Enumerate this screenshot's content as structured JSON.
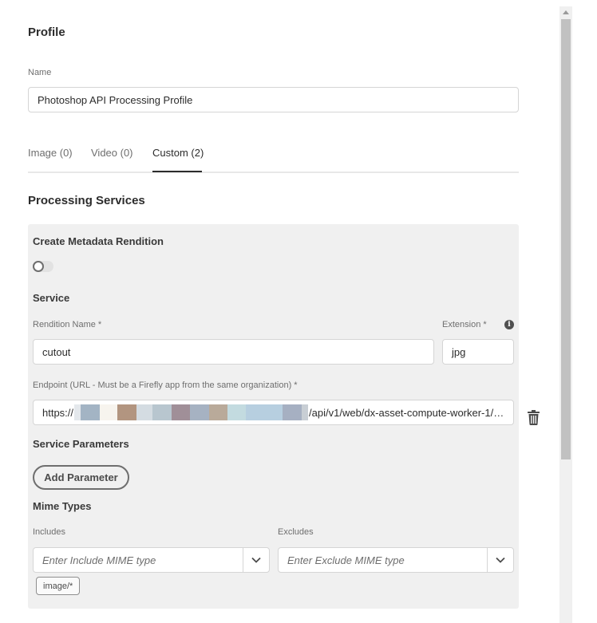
{
  "profile": {
    "heading": "Profile",
    "name_label": "Name",
    "name_value": "Photoshop API Processing Profile"
  },
  "tabs": [
    {
      "label": "Image (0)"
    },
    {
      "label": "Video (0)"
    },
    {
      "label": "Custom (2)",
      "selected": true
    }
  ],
  "processing": {
    "heading": "Processing Services",
    "create_metadata_label": "Create Metadata Rendition",
    "create_metadata_on": false,
    "service_heading": "Service",
    "rendition_label": "Rendition Name *",
    "rendition_value": "cutout",
    "extension_label": "Extension *",
    "extension_value": "jpg",
    "endpoint_label": "Endpoint (URL - Must be a Firefly app from the same organization) *",
    "endpoint_prefix": "https://",
    "endpoint_suffix": "/api/v1/web/dx-asset-compute-worker-1/…",
    "service_params_heading": "Service Parameters",
    "add_parameter_label": "Add Parameter",
    "mime_heading": "Mime Types",
    "includes_label": "Includes",
    "includes_placeholder": "Enter Include MIME type",
    "excludes_label": "Excludes",
    "excludes_placeholder": "Enter Exclude MIME type",
    "include_tags": [
      "image/*"
    ]
  },
  "icons": {
    "info": "info-icon",
    "delete": "trash-icon",
    "dropdown": "chevron-down-icon",
    "scroll_up": "scroll-up-arrow-icon"
  },
  "colors": {
    "text": "#2c2c2c",
    "muted": "#6e6e6e",
    "panel_bg": "#f0f0f0",
    "field_border": "#d5d5d5",
    "tab_indicator": "#2c2c2c"
  }
}
